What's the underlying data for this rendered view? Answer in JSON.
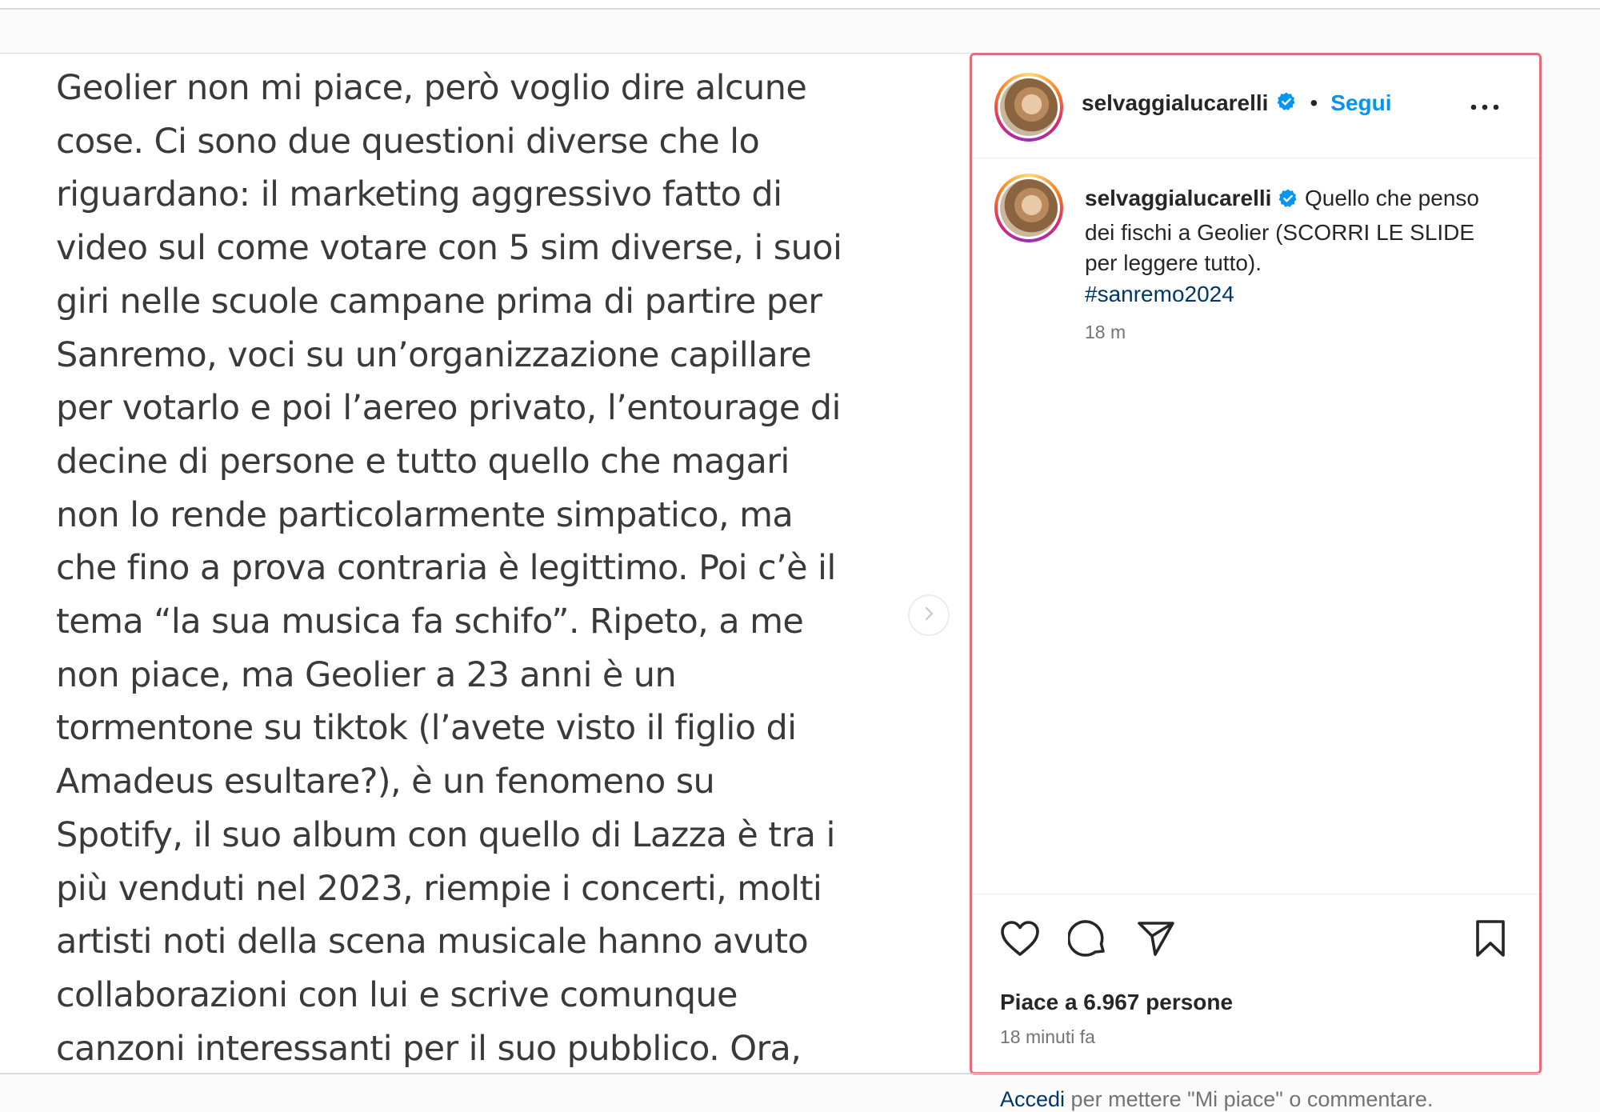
{
  "slide": {
    "lines": [
      "Geolier non mi piace, però voglio dire alcune",
      "cose. Ci sono due questioni diverse che lo",
      "riguardano: il marketing aggressivo fatto di",
      "video sul come votare con 5 sim diverse, i suoi",
      "giri nelle scuole campane prima di partire per",
      "Sanremo, voci su un’organizzazione capillare",
      "per votarlo e poi l’aereo privato, l’entourage di",
      "decine di persone e tutto quello che magari",
      "non lo rende particolarmente simpatico, ma",
      "che fino a prova contraria è legittimo. Poi c’è il",
      "tema “la sua musica fa schifo”. Ripeto, a me",
      "non piace, ma Geolier a 23 anni è un",
      "tormentone su tiktok (l’avete visto il figlio di",
      "Amadeus esultare?), è un fenomeno su",
      "Spotify, il suo album con quello di Lazza è tra i",
      "più venduti nel 2023, riempie i concerti, molti",
      "artisti noti della scena musicale hanno avuto",
      "collaborazioni con lui e scrive comunque",
      "canzoni interessanti per il suo pubblico. Ora,"
    ],
    "next_icon": "chevron-right-icon"
  },
  "header": {
    "username": "selvaggialucarelli",
    "separator": "•",
    "follow_label": "Segui",
    "more_icon": "more-horizontal-icon"
  },
  "caption": {
    "username": "selvaggialucarelli",
    "text": "Quello che penso dei fischi a Geolier (SCORRI LE SLIDE per leggere tutto).",
    "hashtag": "#sanremo2024",
    "time": "18 m"
  },
  "actions": {
    "like_icon": "heart-icon",
    "comment_icon": "comment-icon",
    "share_icon": "send-icon",
    "save_icon": "bookmark-icon"
  },
  "likes_text": "Piace a 6.967 persone",
  "posted_ago": "18 minuti fa",
  "login": {
    "link": "Accedi",
    "rest": " per mettere \"Mi piace\" o commentare."
  },
  "colors": {
    "accent_blue": "#0095f6",
    "hashtag": "#00376b",
    "verified": "#0095f6",
    "highlight_border": "#e0707c"
  }
}
